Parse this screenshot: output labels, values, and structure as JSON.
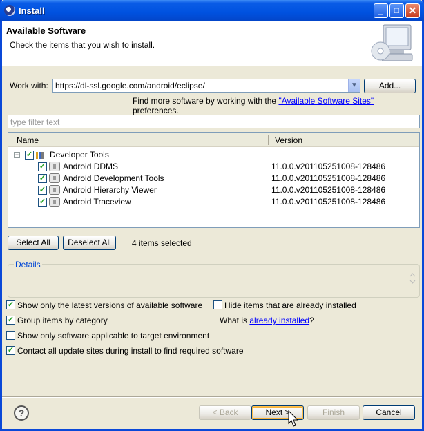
{
  "window": {
    "title": "Install"
  },
  "header": {
    "title": "Available Software",
    "subtitle": "Check the items that you wish to install."
  },
  "work_with": {
    "label": "Work with:",
    "value": "https://dl-ssl.google.com/android/eclipse/",
    "add_label": "Add..."
  },
  "more_sites": {
    "prefix": "Find more software by working with the",
    "link": "\"Available Software Sites\"",
    "suffix": "preferences."
  },
  "filter": {
    "placeholder": "type filter text"
  },
  "table": {
    "columns": [
      "Name",
      "Version"
    ],
    "category": {
      "name": "Developer Tools",
      "checked": true,
      "expanded": true
    },
    "items": [
      {
        "name": "Android DDMS",
        "version": "11.0.0.v201105251008-128486",
        "checked": true
      },
      {
        "name": "Android Development Tools",
        "version": "11.0.0.v201105251008-128486",
        "checked": true
      },
      {
        "name": "Android Hierarchy Viewer",
        "version": "11.0.0.v201105251008-128486",
        "checked": true
      },
      {
        "name": "Android Traceview",
        "version": "11.0.0.v201105251008-128486",
        "checked": true
      }
    ]
  },
  "selection": {
    "select_all": "Select All",
    "deselect_all": "Deselect All",
    "count_text": "4 items selected"
  },
  "details": {
    "label": "Details"
  },
  "options": {
    "latest": {
      "label": "Show only the latest versions of available software",
      "checked": true
    },
    "hide_installed": {
      "label": "Hide items that are already installed",
      "checked": false
    },
    "group": {
      "label": "Group items by category",
      "checked": true
    },
    "what_is_prefix": "What is",
    "what_is_link": "already installed",
    "what_is_suffix": "?",
    "applicable": {
      "label": "Show only software applicable to target environment",
      "checked": false
    },
    "contact": {
      "label": "Contact all update sites during install to find required software",
      "checked": true
    }
  },
  "buttons": {
    "back": "< Back",
    "next": "Next >",
    "finish": "Finish",
    "cancel": "Cancel",
    "help": "?"
  },
  "colors": {
    "titlebar": "#0052e0",
    "link": "#0000ff",
    "checkmark": "#21a121"
  }
}
